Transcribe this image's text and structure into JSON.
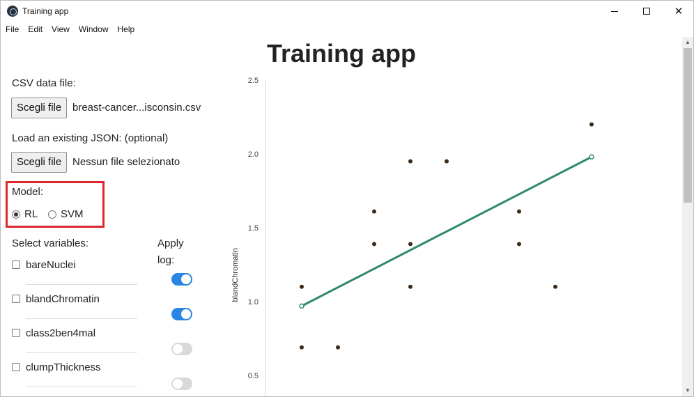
{
  "window": {
    "title": "Training app"
  },
  "menu": [
    "File",
    "Edit",
    "View",
    "Window",
    "Help"
  ],
  "page": {
    "title": "Training app",
    "csv": {
      "label": "CSV data file:",
      "button": "Scegli file",
      "filename": "breast-cancer...isconsin.csv"
    },
    "json": {
      "label": "Load an existing JSON: (optional)",
      "button": "Scegli file",
      "filename": "Nessun file selezionato"
    },
    "model": {
      "label": "Model:",
      "options": [
        {
          "label": "RL",
          "checked": true
        },
        {
          "label": "SVM",
          "checked": false
        }
      ]
    },
    "variables": {
      "label": "Select variables:",
      "apply_log_label_1": "Apply",
      "apply_log_label_2": "log:",
      "items": [
        {
          "name": "bareNuclei",
          "checked": false,
          "log": true
        },
        {
          "name": "blandChromatin",
          "checked": false,
          "log": true
        },
        {
          "name": "class2ben4mal",
          "checked": false,
          "log": false
        },
        {
          "name": "clumpThickness",
          "checked": false,
          "log": false
        }
      ]
    }
  },
  "chart_data": {
    "type": "scatter",
    "ylabel": "blandChromatin",
    "xlabel": "",
    "ylim": [
      0.5,
      2.5
    ],
    "yticks": [
      "0.5",
      "1.0",
      "1.5",
      "2.0",
      "2.5"
    ],
    "xlim": [
      0,
      10
    ],
    "points": [
      {
        "x": 1,
        "y": 1.1
      },
      {
        "x": 1,
        "y": 0.69
      },
      {
        "x": 2,
        "y": 0.69
      },
      {
        "x": 3,
        "y": 1.61
      },
      {
        "x": 3,
        "y": 1.39
      },
      {
        "x": 4,
        "y": 1.95
      },
      {
        "x": 4,
        "y": 1.39
      },
      {
        "x": 4,
        "y": 1.1
      },
      {
        "x": 5,
        "y": 1.95
      },
      {
        "x": 7,
        "y": 1.61
      },
      {
        "x": 7,
        "y": 1.39
      },
      {
        "x": 8,
        "y": 1.1
      },
      {
        "x": 9,
        "y": 2.2
      }
    ],
    "regression_line": {
      "x1": 1,
      "y1": 0.97,
      "x2": 9,
      "y2": 1.98
    },
    "colors": {
      "point": "#3b2a1a",
      "line": "#2e8b66"
    }
  }
}
